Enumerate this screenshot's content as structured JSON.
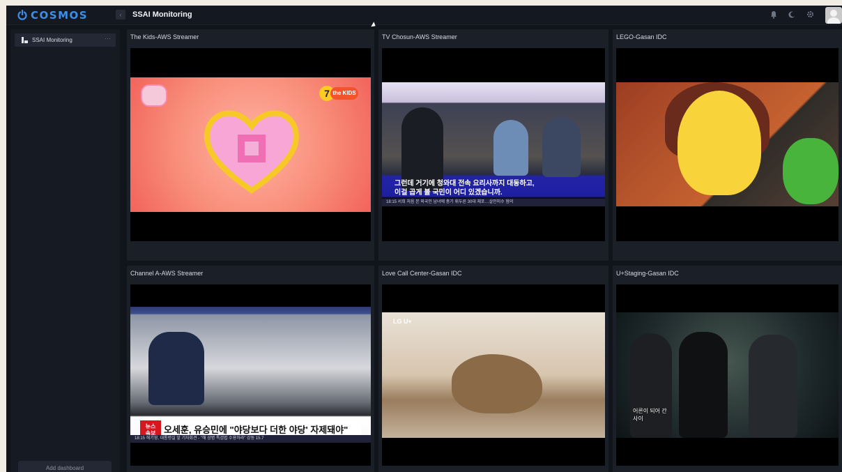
{
  "app": {
    "logo_text": "COSMOS",
    "page_title": "SSAI Monitoring",
    "brand_color": "#3d8ee8"
  },
  "topbar": {
    "icons": [
      "bell-icon",
      "moon-icon",
      "gear-icon",
      "avatar"
    ]
  },
  "sidebar": {
    "items": [
      {
        "label": "SSAI Monitoring",
        "icon": "dashboard-icon",
        "more": "···"
      }
    ],
    "add_dashboard_label": "Add dashboard"
  },
  "panels": [
    {
      "title": "The Kids-AWS Streamer",
      "overlay": {
        "channel_number": "7",
        "channel_logo": "the KIDS"
      }
    },
    {
      "title": "TV Chosun-AWS Streamer",
      "overlay": {
        "subtitle_line1": "그런데 거기에 청와대 전속 요리사까지 대동하고,",
        "subtitle_line2": "이걸 곱게 볼 국민이 어디 있겠습니까.",
        "ticker": "18:15   서희   처음 본 외국인 남녀에 총기 휘두른 30대 체포…살인미수 혐의"
      }
    },
    {
      "title": "LEGO-Gasan IDC",
      "overlay": {}
    },
    {
      "title": "Channel A-AWS Streamer",
      "overlay": {
        "news_tag": "뉴스 속보",
        "headline": "오세훈, 유승민에 \"야당보다 더한 야당' 자제돼야\"",
        "ticker": "18:15   해기영, 대통령실 앞 기자회견 - \"해 상병 특검법 수용하라\"   강동 15.7"
      }
    },
    {
      "title": "Love Call Center-Gasan IDC",
      "overlay": {
        "logo": "LG U+"
      }
    },
    {
      "title": "U+Staging-Gasan IDC",
      "overlay": {
        "subtitle_line1": "어른이 되어 간",
        "subtitle_line2": "사이"
      }
    }
  ]
}
